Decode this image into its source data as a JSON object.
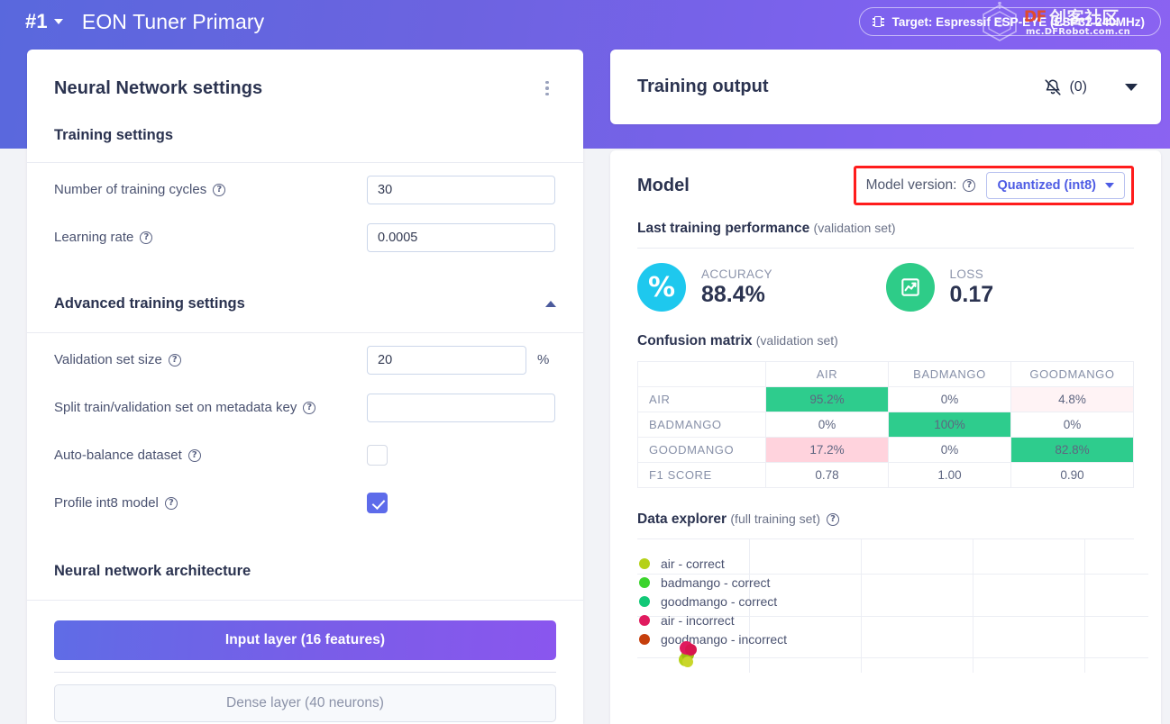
{
  "topbar": {
    "project_number": "#1",
    "project_title": "EON Tuner Primary",
    "target_badge": "Target: Espressif ESP-EYE (ESP32 240MHz)",
    "chip_icon": "chip-icon"
  },
  "watermark": {
    "brand": "DF",
    "brand_cn": "创客社区",
    "url": "mc.DFRobot.com.cn"
  },
  "left_panel": {
    "title": "Neural Network settings",
    "kebab_icon": "kebab-menu-icon",
    "training_settings_title": "Training settings",
    "fields": [
      {
        "label": "Number of training cycles",
        "value": "30",
        "placeholder": ""
      },
      {
        "label": "Learning rate",
        "value": "0.0005",
        "placeholder": ""
      }
    ],
    "advanced_title": "Advanced training settings",
    "advanced_collapse_icon": "chevron-up-icon",
    "advanced_fields": [
      {
        "label": "Validation set size",
        "value": "20",
        "suffix": "%"
      },
      {
        "label": "Split train/validation set on metadata key",
        "value": "",
        "suffix": ""
      }
    ],
    "toggles": [
      {
        "label": "Auto-balance dataset",
        "checked": false
      },
      {
        "label": "Profile int8 model",
        "checked": true
      }
    ],
    "architecture_title": "Neural network architecture",
    "layers": [
      {
        "label": "Input layer (16 features)",
        "kind": "input"
      },
      {
        "label": "Dense layer (40 neurons)",
        "kind": "dense"
      }
    ]
  },
  "right_panel": {
    "training_output_title": "Training output",
    "bell_icon": "bell-off-icon",
    "bell_count": "(0)",
    "expand_icon": "chevron-down-icon",
    "model_title": "Model",
    "model_version_label": "Model version:",
    "model_version_help_icon": "help-circle-icon",
    "model_version_value": "Quantized (int8)",
    "model_version_caret_icon": "chevron-down-icon",
    "highlight_color": "#ff1c1c",
    "last_training_title": "Last training performance",
    "last_training_suffix": "(validation set)",
    "metrics": [
      {
        "icon": "percent-icon",
        "label": "ACCURACY",
        "value": "88.4%",
        "color": "#1ec8ee"
      },
      {
        "icon": "chart-line-icon",
        "label": "LOSS",
        "value": "0.17",
        "color": "#2ecc88"
      }
    ],
    "confusion_title": "Confusion matrix",
    "confusion_suffix": "(validation set)",
    "data_explorer_title": "Data explorer",
    "data_explorer_suffix": "(full training set)",
    "data_explorer_help_icon": "help-circle-icon"
  },
  "chart_data": {
    "type": "table",
    "title": "Confusion matrix (validation set)",
    "columns": [
      "",
      "AIR",
      "BADMANGO",
      "GOODMANGO"
    ],
    "rows": [
      {
        "label": "AIR",
        "cells": [
          "95.2%",
          "0%",
          "4.8%"
        ],
        "styles": [
          "good",
          "plain",
          "bad-light"
        ]
      },
      {
        "label": "BADMANGO",
        "cells": [
          "0%",
          "100%",
          "0%"
        ],
        "styles": [
          "plain",
          "good",
          "plain"
        ]
      },
      {
        "label": "GOODMANGO",
        "cells": [
          "17.2%",
          "0%",
          "82.8%"
        ],
        "styles": [
          "bad-strong",
          "plain",
          "good"
        ]
      },
      {
        "label": "F1 SCORE",
        "cells": [
          "0.78",
          "1.00",
          "0.90"
        ],
        "styles": [
          "plain",
          "plain",
          "plain"
        ]
      }
    ]
  },
  "data_explorer_chart": {
    "type": "scatter",
    "title": "Data explorer (full training set)",
    "legend": [
      {
        "label": "air - correct",
        "color": "#b5d118"
      },
      {
        "label": "badmango - correct",
        "color": "#3bd42c"
      },
      {
        "label": "goodmango - correct",
        "color": "#12c877"
      },
      {
        "label": "air - incorrect",
        "color": "#e01a5e"
      },
      {
        "label": "goodmango - incorrect",
        "color": "#c63f0c"
      }
    ],
    "grid": true,
    "points_note": "dense cluster at lower-left"
  }
}
